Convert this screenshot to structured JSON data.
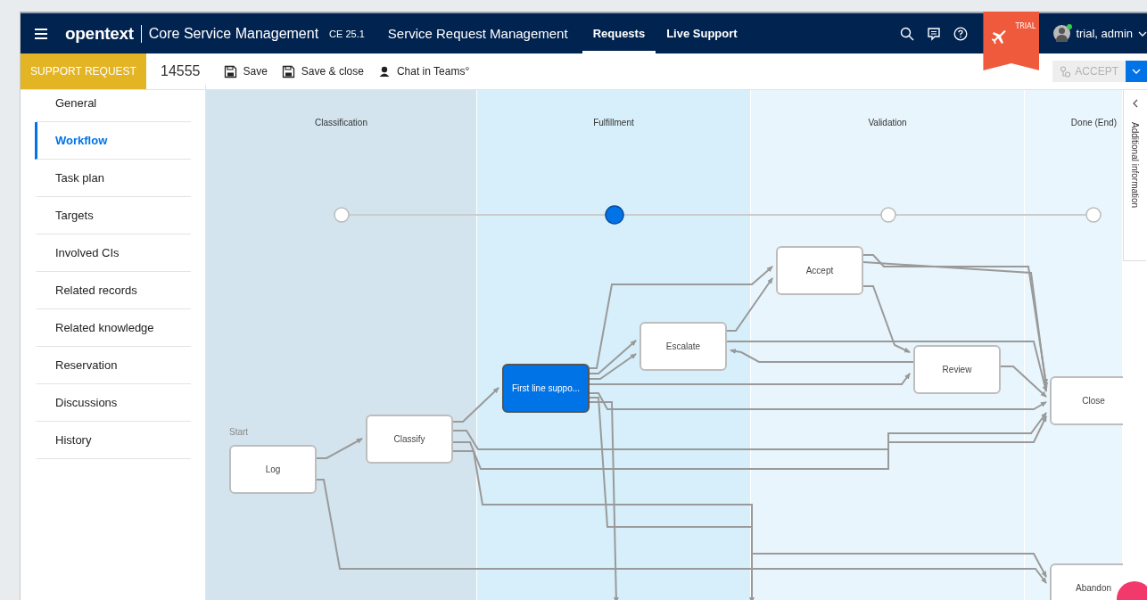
{
  "header": {
    "brand": "opentext",
    "product": "Core Service Management",
    "version": "CE 25.1",
    "module": "Service Request Management",
    "nav": [
      {
        "label": "Requests",
        "selected": true
      },
      {
        "label": "Live Support",
        "selected": false
      }
    ],
    "trial_badge": "TRIAL",
    "user": "trial, admin"
  },
  "record": {
    "type": "SUPPORT REQUEST",
    "id": "14555",
    "actions": [
      "Save",
      "Save & close",
      "Chat in Teams°"
    ],
    "accept_button": {
      "label": "ACCEPT",
      "disabled": true
    }
  },
  "sidebar": {
    "items": [
      {
        "label": "General",
        "selected": false
      },
      {
        "label": "Workflow",
        "selected": true
      },
      {
        "label": "Task plan",
        "selected": false
      },
      {
        "label": "Targets",
        "selected": false
      },
      {
        "label": "Involved CIs",
        "selected": false
      },
      {
        "label": "Related records",
        "selected": false
      },
      {
        "label": "Related knowledge",
        "selected": false
      },
      {
        "label": "Reservation",
        "selected": false
      },
      {
        "label": "Discussions",
        "selected": false
      },
      {
        "label": "History",
        "selected": false
      }
    ]
  },
  "workflow": {
    "phases": [
      {
        "label": "Classification",
        "current": false
      },
      {
        "label": "Fulfillment",
        "current": true
      },
      {
        "label": "Validation",
        "current": false
      },
      {
        "label": "Done (End)",
        "current": false
      }
    ],
    "nodes": [
      {
        "label": "Log",
        "caption": "Start",
        "selected": false
      },
      {
        "label": "Classify",
        "selected": false
      },
      {
        "label": "First line suppo...",
        "selected": true
      },
      {
        "label": "Escalate",
        "selected": false
      },
      {
        "label": "Accept",
        "selected": false
      },
      {
        "label": "Review",
        "selected": false
      },
      {
        "label": "Close",
        "selected": false
      },
      {
        "label": "Abandon",
        "selected": false
      }
    ]
  },
  "side_panel": {
    "label": "Additional information"
  }
}
